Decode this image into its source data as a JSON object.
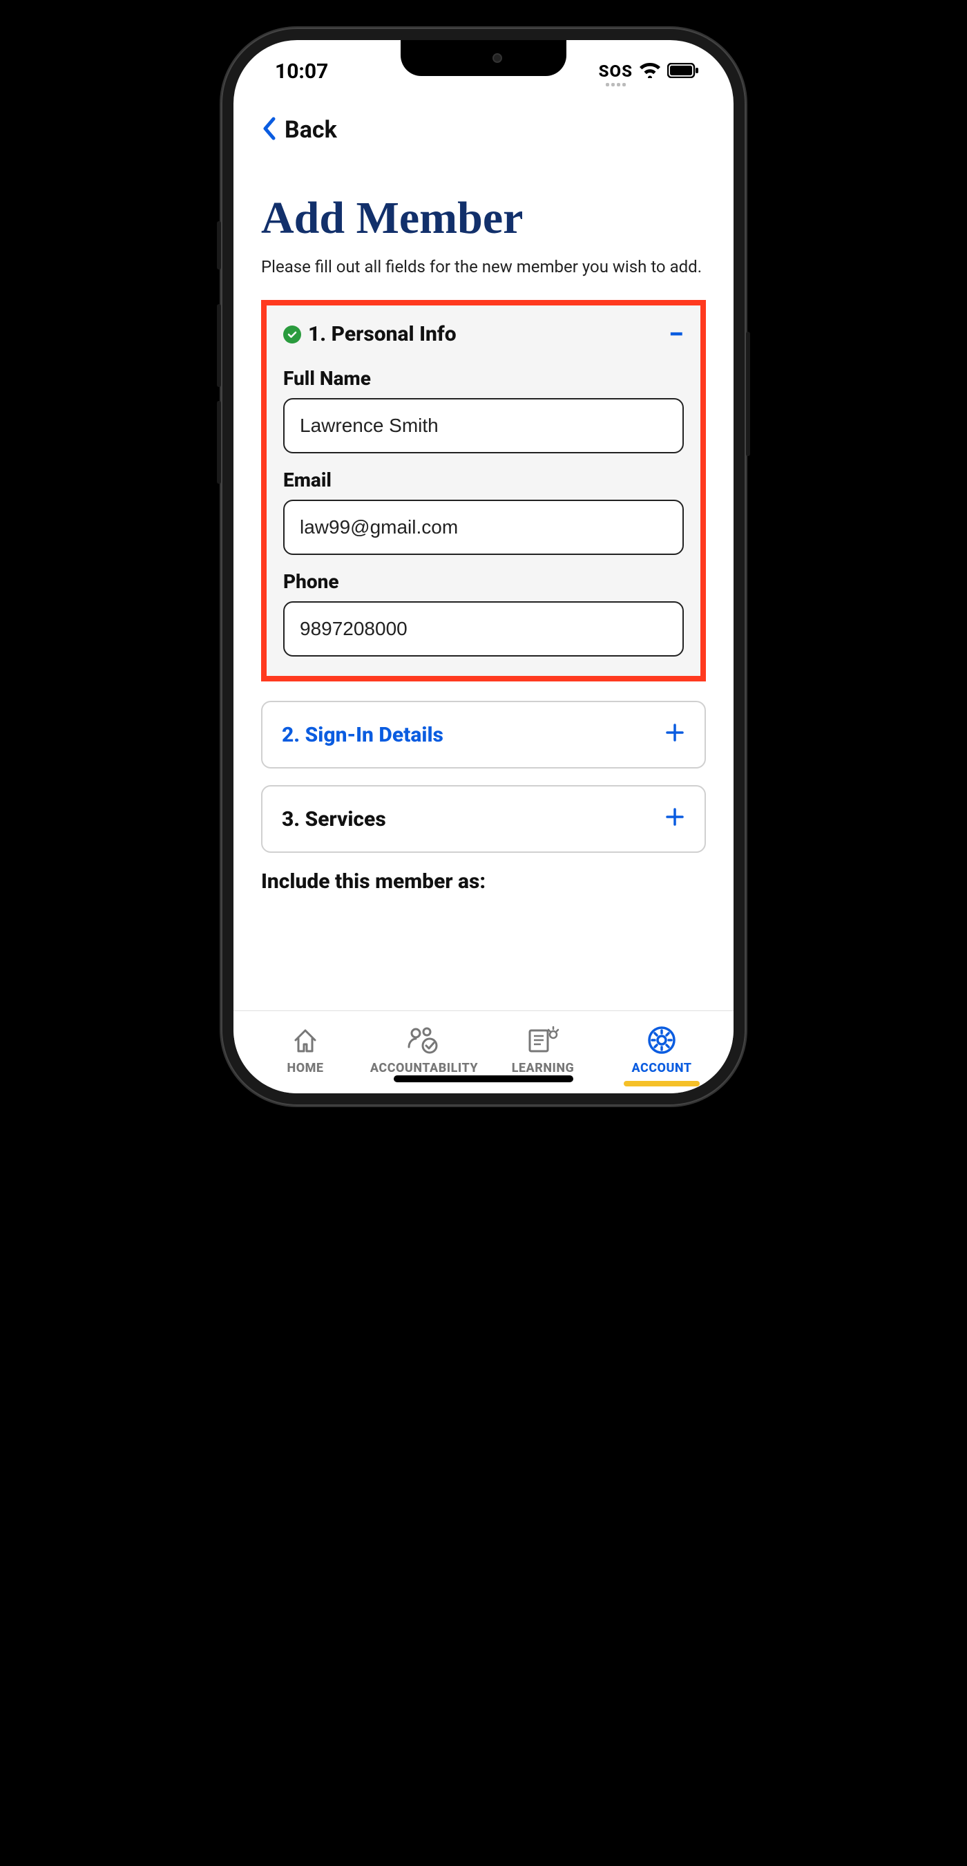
{
  "status": {
    "time": "10:07",
    "sos": "SOS"
  },
  "nav": {
    "back_label": "Back"
  },
  "page": {
    "title": "Add Member",
    "subtitle": "Please fill out all fields for the new member you wish to add."
  },
  "section1": {
    "title": "1. Personal Info",
    "full_name_label": "Full Name",
    "full_name_value": "Lawrence Smith",
    "email_label": "Email",
    "email_value": "law99@gmail.com",
    "phone_label": "Phone",
    "phone_況value": "9897208000",
    "phone_value": "9897208000"
  },
  "section2": {
    "title": "2. Sign-In Details"
  },
  "section3": {
    "title": "3. Services"
  },
  "include": {
    "label": "Include this member as:"
  },
  "bottom_nav": {
    "home": "HOME",
    "accountability": "ACCOUNTABILITY",
    "learning": "LEARNING",
    "account": "ACCOUNT"
  }
}
